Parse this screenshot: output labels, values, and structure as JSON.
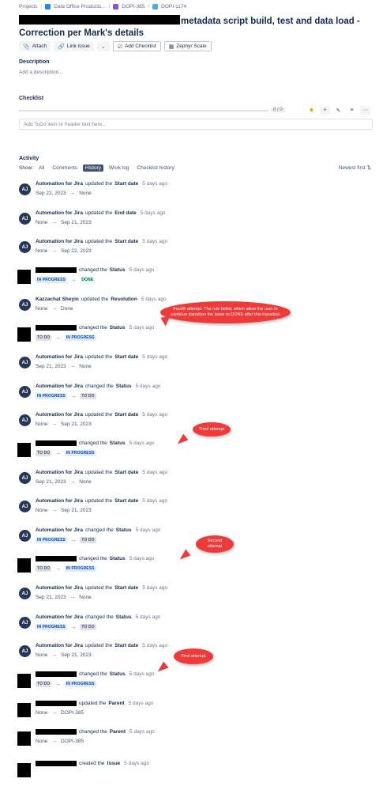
{
  "breadcrumb": {
    "projects": "Projects",
    "space": "Data Office Products...",
    "parent": "DOPI-385",
    "issue": "DOPI-1174"
  },
  "issue": {
    "title": "metadata script build, test and data load - Correction per Mark's details"
  },
  "toolbar": {
    "attach": "Attach",
    "link_issue": "Link issue",
    "add_checklist": "Add Checklist",
    "zephyr": "Zephyr Scale"
  },
  "description": {
    "label": "Description",
    "placeholder": "Add a description..."
  },
  "checklist": {
    "label": "Checklist",
    "count": "0 / 0",
    "progress": 0,
    "input_placeholder": "Add ToDo item or header text here..."
  },
  "activity": {
    "label": "Activity",
    "show_label": "Show:",
    "tabs": [
      "All",
      "Comments",
      "History",
      "Work log",
      "Checklist history"
    ],
    "selected_tab": "History",
    "sort": "Newest first"
  },
  "history": [
    {
      "who": "Automation for Jira",
      "verb": "updated the",
      "field": "Start date",
      "time": "5 days ago",
      "from": "Sep 22, 2023",
      "to": "None"
    },
    {
      "who": "Automation for Jira",
      "verb": "updated the",
      "field": "End date",
      "time": "5 days ago",
      "from": "None",
      "to": "Sep 21, 2023"
    },
    {
      "who": "Automation for Jira",
      "verb": "updated the",
      "field": "Start date",
      "time": "5 days ago",
      "from": "None",
      "to": "Sep 22, 2023"
    },
    {
      "who": "",
      "verb": "changed the",
      "field": "Status",
      "time": "5 days ago",
      "from": "IN PROGRESS",
      "to": "DONE"
    },
    {
      "who": "Kazzachat Sheyin",
      "verb": "updated the",
      "field": "Resolution",
      "time": "5 days ago",
      "from": "None",
      "to": "Done"
    },
    {
      "who": "",
      "verb": "changed the",
      "field": "Status",
      "time": "5 days ago",
      "from": "TO DO",
      "to": "IN PROGRESS"
    },
    {
      "who": "Automation for Jira",
      "verb": "updated the",
      "field": "Start date",
      "time": "5 days ago",
      "from": "Sep 21, 2023",
      "to": "None"
    },
    {
      "who": "Automation for Jira",
      "verb": "changed the",
      "field": "Status",
      "time": "5 days ago",
      "from": "IN PROGRESS",
      "to": "TO DO"
    },
    {
      "who": "Automation for Jira",
      "verb": "updated the",
      "field": "Start date",
      "time": "5 days ago",
      "from": "None",
      "to": "Sep 21, 2023"
    },
    {
      "who": "",
      "verb": "changed the",
      "field": "Status",
      "time": "5 days ago",
      "from": "TO DO",
      "to": "IN PROGRESS"
    },
    {
      "who": "Automation for Jira",
      "verb": "updated the",
      "field": "Start date",
      "time": "5 days ago",
      "from": "Sep 21, 2023",
      "to": "None"
    },
    {
      "who": "Automation for Jira",
      "verb": "updated the",
      "field": "Start date",
      "time": "5 days ago",
      "from": "None",
      "to": "Sep 21, 2023"
    },
    {
      "who": "Automation for Jira",
      "verb": "changed the",
      "field": "Status",
      "time": "5 days ago",
      "from": "IN PROGRESS",
      "to": "TO DO"
    },
    {
      "who": "",
      "verb": "changed the",
      "field": "Status",
      "time": "5 days ago",
      "from": "TO DO",
      "to": "IN PROGRESS"
    },
    {
      "who": "Automation for Jira",
      "verb": "updated the",
      "field": "Start date",
      "time": "5 days ago",
      "from": "Sep 21, 2023",
      "to": "None"
    },
    {
      "who": "Automation for Jira",
      "verb": "changed the",
      "field": "Status",
      "time": "5 days ago",
      "from": "IN PROGRESS",
      "to": "TO DO"
    },
    {
      "who": "Automation for Jira",
      "verb": "updated the",
      "field": "Start date",
      "time": "5 days ago",
      "from": "None",
      "to": "Sep 21, 2023"
    },
    {
      "who": "",
      "verb": "changed the",
      "field": "Status",
      "time": "5 days ago",
      "from": "TO DO",
      "to": "IN PROGRESS"
    },
    {
      "who": "",
      "verb": "updated the",
      "field": "Parent",
      "time": "5 days ago",
      "from": "None",
      "to": "DOPI-385"
    },
    {
      "who": "",
      "verb": "changed the",
      "field": "Parent",
      "time": "5 days ago",
      "from": "None",
      "to": "DOPI-385"
    },
    {
      "who": "",
      "verb": "created the",
      "field": "Issue",
      "time": "5 days ago",
      "from": "",
      "to": ""
    }
  ],
  "avatar_initials": "AJ",
  "callouts": [
    {
      "text": "Fourth  attempt. The rule failed, which allow the user to continue transition the issue to DONE after this transition"
    },
    {
      "text": "Third attempt"
    },
    {
      "text": "Second attempt"
    },
    {
      "text": "First attempt"
    }
  ],
  "icons": {
    "attach": "paperclip-icon",
    "link": "link-icon",
    "checklist": "checkbox-icon",
    "zephyr": "zephyr-icon",
    "sort": "sort-icon"
  },
  "colors": {
    "callout": "#ef3a3a",
    "avatar": "#253858",
    "selected_tab": "#42526e",
    "in_progress": "#0747a6",
    "done": "#006644"
  }
}
